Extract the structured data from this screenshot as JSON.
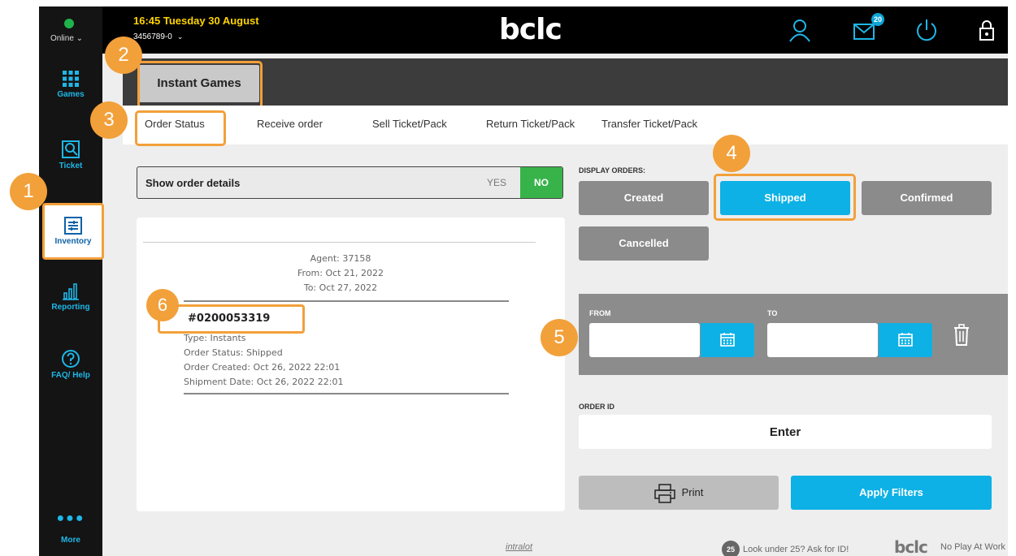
{
  "status": {
    "online_label": "Online"
  },
  "topbar": {
    "datetime": "16:45 Tuesday 30 August",
    "account": "3456789-0",
    "logo_text": "bclc",
    "message_count": "20"
  },
  "sidebar": {
    "items": [
      {
        "label": "Games",
        "icon": "grid-icon"
      },
      {
        "label": "Ticket",
        "icon": "ticket-scan-icon"
      },
      {
        "label": "Inventory",
        "icon": "inventory-icon"
      },
      {
        "label": "Reporting",
        "icon": "bar-chart-icon"
      },
      {
        "label": "FAQ/ Help",
        "icon": "question-icon"
      },
      {
        "label": "More",
        "icon": "ellipsis-icon"
      }
    ]
  },
  "page": {
    "title": "Instant Games"
  },
  "tabs": [
    {
      "label": "Order Status"
    },
    {
      "label": "Receive order"
    },
    {
      "label": "Sell Ticket/Pack"
    },
    {
      "label": "Return Ticket/Pack"
    },
    {
      "label": "Transfer Ticket/Pack"
    }
  ],
  "order_details": {
    "label": "Show order details",
    "yes": "YES",
    "no": "NO"
  },
  "receipt": {
    "agent": "Agent: 37158",
    "from": "From: Oct 21, 2022",
    "to": "To: Oct 27, 2022",
    "order_number": "#0200053319",
    "type": "Type: Instants",
    "status": "Order Status: Shipped",
    "created": "Order Created: Oct 26, 2022 22:01",
    "shipment": "Shipment Date: Oct 26, 2022 22:01"
  },
  "filters": {
    "display_label": "DISPLAY ORDERS:",
    "buttons": [
      {
        "label": "Created"
      },
      {
        "label": "Shipped",
        "selected": true
      },
      {
        "label": "Confirmed"
      },
      {
        "label": "Cancelled"
      }
    ],
    "from_label": "FROM",
    "to_label": "TO",
    "order_id_label": "ORDER ID",
    "order_id_placeholder": "Enter",
    "print_label": "Print",
    "apply_label": "Apply Filters"
  },
  "footer": {
    "partner": "intralot",
    "age_badge": "25",
    "age_text": "Look under 25? Ask for ID!",
    "brand": "bclc",
    "tagline": "No Play At Work"
  },
  "callouts": [
    "1",
    "2",
    "3",
    "4",
    "5",
    "6"
  ],
  "colors": {
    "accent": "#0db1e5",
    "callout": "#f2a03a",
    "success": "#37b34a",
    "sidebar_text": "#1eb7e8"
  }
}
